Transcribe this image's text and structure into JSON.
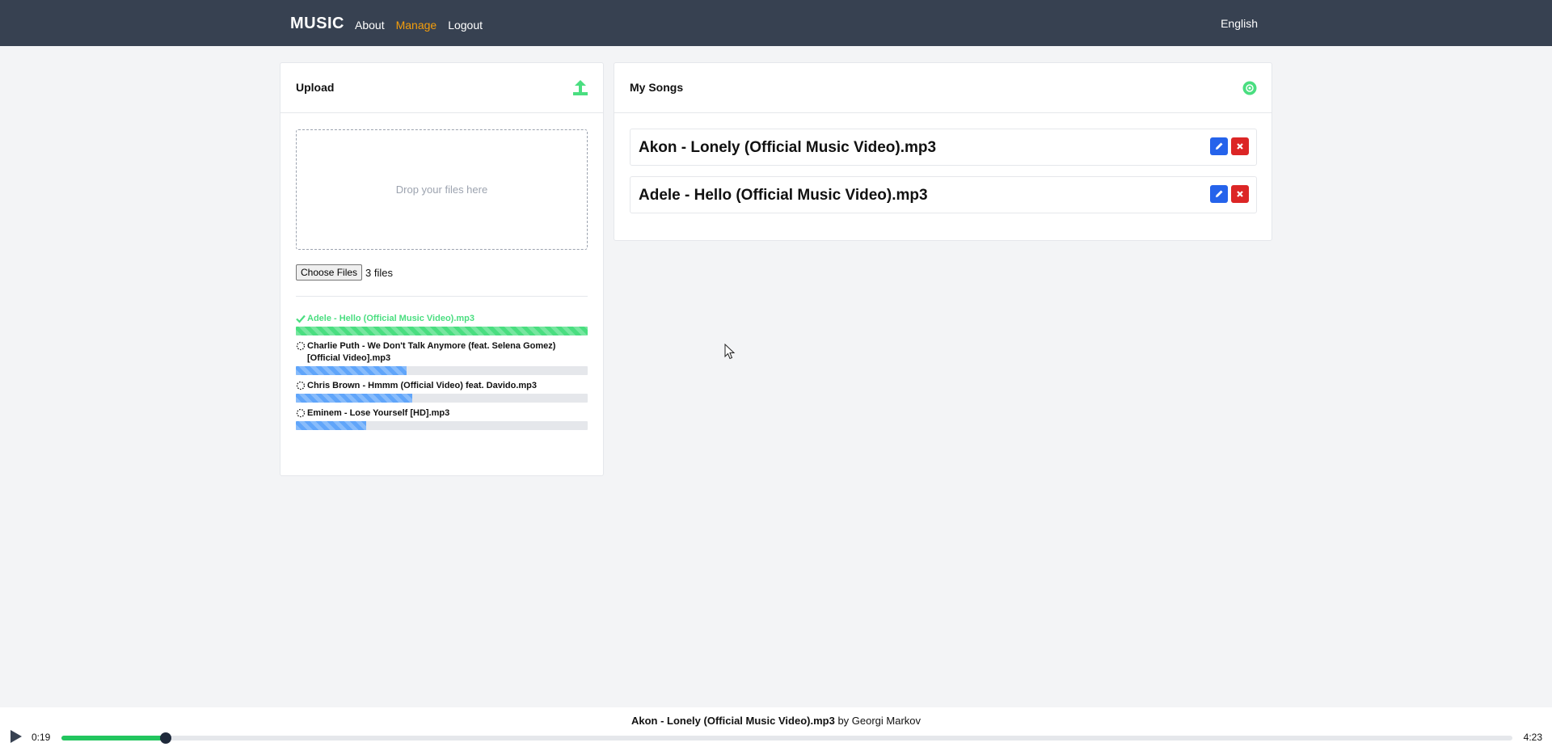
{
  "header": {
    "brand": "MUSIC",
    "nav": [
      {
        "label": "About"
      },
      {
        "label": "Manage",
        "active": true
      },
      {
        "label": "Logout"
      }
    ],
    "language": "English",
    "background": "#374151",
    "active_color": "#f59e0b"
  },
  "upload": {
    "title": "Upload",
    "icon": "upload-icon",
    "dropzone_text": "Drop your files here",
    "choose_button": "Choose Files",
    "file_count": "3 files",
    "items": [
      {
        "name": "Adele - Hello (Official Music Video).mp3",
        "status": "done",
        "progress": 100
      },
      {
        "name": "Charlie Puth - We Don't Talk Anymore (feat. Selena Gomez) [Official Video].mp3",
        "status": "uploading",
        "progress": 38
      },
      {
        "name": "Chris Brown - Hmmm (Official Video) feat. Davido.mp3",
        "status": "uploading",
        "progress": 40
      },
      {
        "name": "Eminem - Lose Yourself [HD].mp3",
        "status": "uploading",
        "progress": 24
      }
    ]
  },
  "songs": {
    "title": "My Songs",
    "icon": "refresh-icon",
    "items": [
      {
        "title": "Akon - Lonely (Official Music Video).mp3"
      },
      {
        "title": "Adele - Hello (Official Music Video).mp3"
      }
    ]
  },
  "player": {
    "song": "Akon - Lonely (Official Music Video).mp3",
    "by": "by Georgi Markov",
    "current_time": "0:19",
    "duration": "4:23",
    "progress": 7.2
  }
}
